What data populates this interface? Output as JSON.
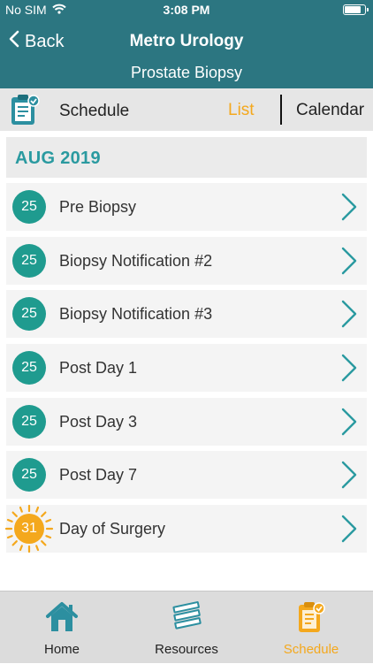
{
  "status_bar": {
    "carrier": "No SIM",
    "time": "3:08 PM",
    "battery_level": 0.9
  },
  "nav": {
    "back_label": "Back",
    "title": "Metro Urology",
    "subtitle": "Prostate Biopsy"
  },
  "toolbar": {
    "section_label": "Schedule",
    "list_label": "List",
    "calendar_label": "Calendar"
  },
  "month_header": "AUG 2019",
  "events": [
    {
      "day": "25",
      "label": "Pre Biopsy"
    },
    {
      "day": "25",
      "label": "Biopsy Notification #2"
    },
    {
      "day": "25",
      "label": "Biopsy Notification #3"
    },
    {
      "day": "25",
      "label": "Post Day 1"
    },
    {
      "day": "25",
      "label": "Post Day 3"
    },
    {
      "day": "25",
      "label": "Post Day 7"
    },
    {
      "day": "31",
      "label": "Day of Surgery"
    }
  ],
  "tab_bar": {
    "home": "Home",
    "resources": "Resources",
    "schedule": "Schedule"
  },
  "colors": {
    "header": "#2c7681",
    "accent": "#f4a81d",
    "badge": "#1f9b8f",
    "month_text": "#2a9aa0",
    "chevron": "#2a9aa0"
  }
}
